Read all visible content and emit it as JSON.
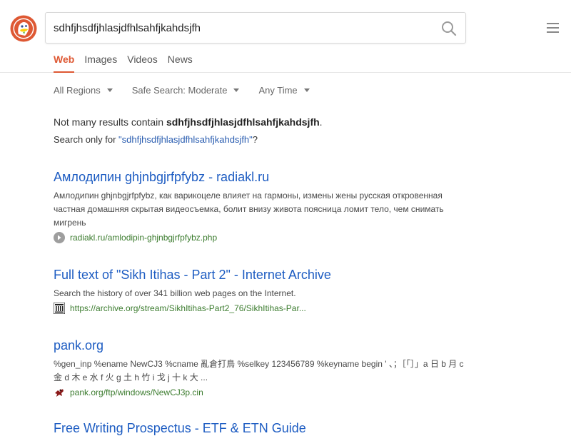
{
  "header": {
    "search_value": "sdhfjhsdfjhlasjdfhlsahfjkahdsjfh",
    "tabs": [
      {
        "label": "Web",
        "active": true
      },
      {
        "label": "Images",
        "active": false
      },
      {
        "label": "Videos",
        "active": false
      },
      {
        "label": "News",
        "active": false
      }
    ]
  },
  "filters": {
    "region": "All Regions",
    "safe_search": "Safe Search: Moderate",
    "time": "Any Time"
  },
  "notice": {
    "prefix": "Not many results contain ",
    "term": "sdhfjhsdfjhlasjdfhlsahfjkahdsjfh",
    "suffix": ".",
    "only_prefix": "Search only for ",
    "only_link": "\"sdhfjhsdfjhlasjdfhlsahfjkahdsjfh\"",
    "only_suffix": "?"
  },
  "results": [
    {
      "title": "Амлодипин ghjnbgjrfpfybz - radiakl.ru",
      "snippet": "Амлодипин ghjnbgjrfpfybz, как варикоцеле влияет на гармоны, измены жены русская откровенная частная домашняя скрытая видеосъемка, болит внизу живота поясница ломит тело, чем снимать мигрень",
      "url": "radiakl.ru/amlodipin-ghjnbgjrfpfybz.php",
      "favicon": "grey-arrow-icon"
    },
    {
      "title": "Full text of \"Sikh Itihas - Part 2\" - Internet Archive",
      "snippet": "Search the history of over 341 billion web pages on the Internet.",
      "url": "https://archive.org/stream/SikhItihas-Part2_76/SikhItihas-Par...",
      "favicon": "archive-icon"
    },
    {
      "title": "pank.org",
      "snippet": "%gen_inp %ename NewCJ3 %cname 亂倉打鳥 %selkey 123456789 %keyname begin ' 、；［「］」a 日 b 月 c 金 d 木 e 水 f 火 g 土 h 竹 i 戈 j 十 k 大 ...",
      "url": "pank.org/ftp/windows/NewCJ3p.cin",
      "favicon": "pank-icon"
    },
    {
      "title": "Free Writing Prospectus - ETF & ETN Guide",
      "snippet": "",
      "url": "",
      "favicon": ""
    }
  ],
  "colors": {
    "accent": "#de5833",
    "link": "#1d5cc2",
    "url": "#3c7c2f"
  }
}
